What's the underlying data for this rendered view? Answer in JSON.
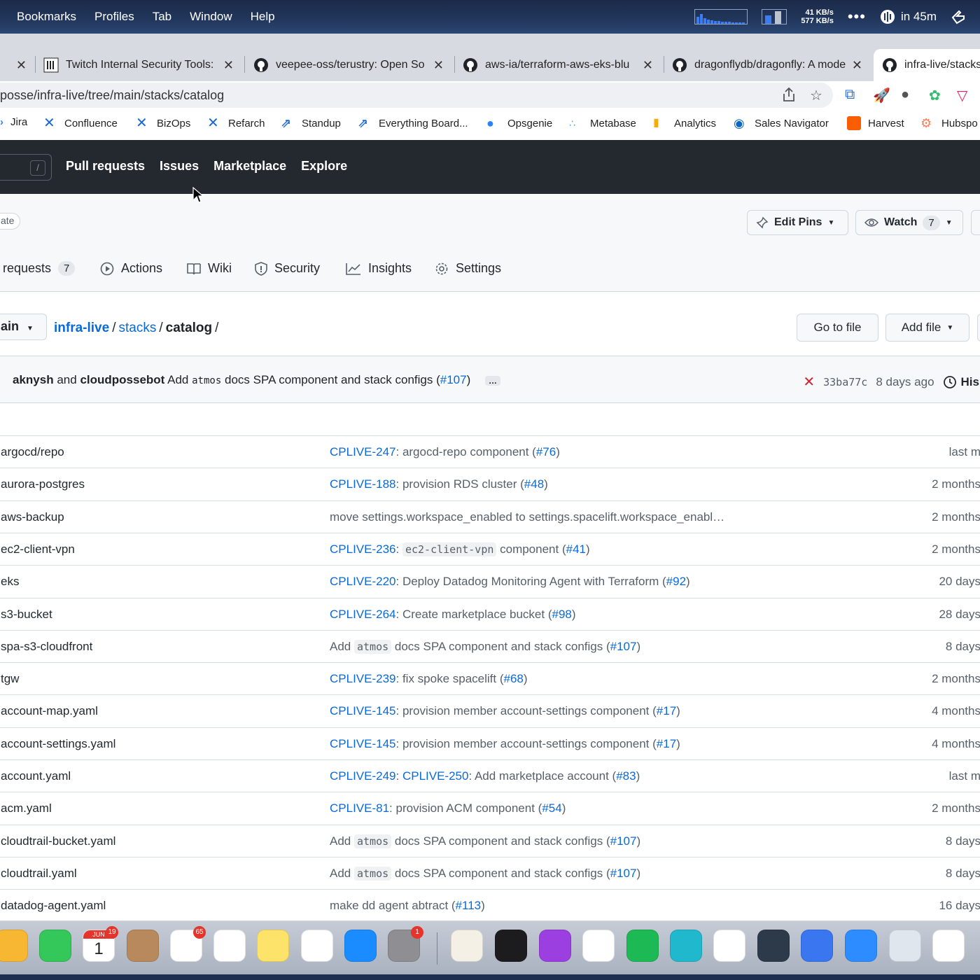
{
  "menubar": {
    "items": [
      "Bookmarks",
      "Profiles",
      "Tab",
      "Window",
      "Help"
    ],
    "net_up": "41 KB/s",
    "net_down": "577 KB/s",
    "more": "•••",
    "clock_text": "in 45m"
  },
  "tabs": [
    {
      "title": "Twitch Internal Security Tools:",
      "icon": "twitch-icon"
    },
    {
      "title": "veepee-oss/terustry: Open So",
      "icon": "github-icon"
    },
    {
      "title": "aws-ia/terraform-aws-eks-blu",
      "icon": "github-icon"
    },
    {
      "title": "dragonflydb/dragonfly: A mode",
      "icon": "github-icon"
    },
    {
      "title": "infra-live/stacks",
      "icon": "github-icon"
    }
  ],
  "address": {
    "url": "posse/infra-live/tree/main/stacks/catalog"
  },
  "bookmarks": [
    {
      "label": "Jira",
      "color": "#2684ff"
    },
    {
      "label": "Confluence",
      "color": "#1868db"
    },
    {
      "label": "BizOps",
      "color": "#1868db"
    },
    {
      "label": "Refarch",
      "color": "#1868db"
    },
    {
      "label": "Standup",
      "color": "#1868db"
    },
    {
      "label": "Everything Board...",
      "color": "#1868db"
    },
    {
      "label": "Opsgenie",
      "color": "#2684ff"
    },
    {
      "label": "Metabase",
      "color": "#509ee3"
    },
    {
      "label": "Analytics",
      "color": "#f9ab00"
    },
    {
      "label": "Sales Navigator",
      "color": "#0a66c2"
    },
    {
      "label": "Harvest",
      "color": "#fa5d00"
    },
    {
      "label": "Hubspo",
      "color": "#ff7a59"
    }
  ],
  "gh_nav": {
    "slash": "/",
    "items": [
      "Pull requests",
      "Issues",
      "Marketplace",
      "Explore"
    ]
  },
  "repo": {
    "visibility_pill": "ate",
    "edit_pins": "Edit Pins",
    "watch": "Watch",
    "watch_count": "7",
    "tabs": [
      {
        "label": "requests",
        "count": "7"
      },
      {
        "label": "Actions"
      },
      {
        "label": "Wiki"
      },
      {
        "label": "Security"
      },
      {
        "label": "Insights"
      },
      {
        "label": "Settings"
      }
    ]
  },
  "breadcrumb": {
    "branch": "ain",
    "root": "infra-live",
    "dir": "stacks",
    "current": "catalog",
    "sep": "/",
    "go_to_file": "Go to file",
    "add_file": "Add file"
  },
  "commit": {
    "author1": "aknysh",
    "and": "and",
    "author2": "cloudpossebot",
    "msg_pre": "Add",
    "msg_code": "atmos",
    "msg_post": "docs SPA component and stack configs (",
    "pr": "#107",
    "msg_close": ")",
    "ellipsis": "…",
    "status": "✕",
    "sha": "33ba77c",
    "age": "8 days ago",
    "history": "His"
  },
  "files": [
    {
      "name": "argocd/repo",
      "link": "CPLIVE-247",
      "text": ": argocd-repo component (",
      "pr": "#76",
      "age": "last m"
    },
    {
      "name": "aurora-postgres",
      "link": "CPLIVE-188",
      "text": ": provision RDS cluster (",
      "pr": "#48",
      "age": "2 months"
    },
    {
      "name": "aws-backup",
      "plain": "move settings.workspace_enabled to settings.spacelift.workspace_enabl…",
      "age": "2 months"
    },
    {
      "name": "ec2-client-vpn",
      "link": "CPLIVE-236",
      "text": ": ",
      "code": "ec2-client-vpn",
      "text2": " component (",
      "pr": "#41",
      "age": "2 months"
    },
    {
      "name": "eks",
      "link": "CPLIVE-220",
      "text": ": Deploy Datadog Monitoring Agent with Terraform (",
      "pr": "#92",
      "age": "20 days"
    },
    {
      "name": "s3-bucket",
      "link": "CPLIVE-264",
      "text": ": Create marketplace bucket (",
      "pr": "#98",
      "age": "28 days"
    },
    {
      "name": "spa-s3-cloudfront",
      "pre": "Add ",
      "code": "atmos",
      "text2": " docs SPA component and stack configs (",
      "pr": "#107",
      "age": "8 days"
    },
    {
      "name": "tgw",
      "link": "CPLIVE-239",
      "text": ": fix spoke spacelift (",
      "pr": "#68",
      "age": "2 months"
    },
    {
      "name": "account-map.yaml",
      "link": "CPLIVE-145",
      "text": ": provision member account-settings component (",
      "pr": "#17",
      "age": "4 months"
    },
    {
      "name": "account-settings.yaml",
      "link": "CPLIVE-145",
      "text": ": provision member account-settings component (",
      "pr": "#17",
      "age": "4 months"
    },
    {
      "name": "account.yaml",
      "link": "CPLIVE-249",
      "text": ": ",
      "link2": "CPLIVE-250",
      "text2": ": Add marketplace account (",
      "pr": "#83",
      "age": "last m"
    },
    {
      "name": "acm.yaml",
      "link": "CPLIVE-81",
      "text": ": provision ACM component (",
      "pr": "#54",
      "age": "2 months"
    },
    {
      "name": "cloudtrail-bucket.yaml",
      "pre": "Add ",
      "code": "atmos",
      "text2": " docs SPA component and stack configs (",
      "pr": "#107",
      "age": "8 days"
    },
    {
      "name": "cloudtrail.yaml",
      "pre": "Add ",
      "code": "atmos",
      "text2": " docs SPA component and stack configs (",
      "pr": "#107",
      "age": "8 days"
    },
    {
      "name": "datadog-agent.yaml",
      "pre": "make dd agent abtract (",
      "pr": "#113",
      "age": "16 days"
    }
  ],
  "dock": {
    "apps": [
      {
        "name": "photos-app",
        "color": "#f7b733"
      },
      {
        "name": "facetime-app",
        "color": "#34c759"
      },
      {
        "name": "calendar-app",
        "color": "#ffffff",
        "badge": "19",
        "month": "JUN",
        "day": "1"
      },
      {
        "name": "contacts-app",
        "color": "#b8895c"
      },
      {
        "name": "reminders-app",
        "color": "#ffffff",
        "badge": "65"
      },
      {
        "name": "slack-app",
        "color": "#ffffff"
      },
      {
        "name": "notes-app",
        "color": "#fde36a"
      },
      {
        "name": "news-app",
        "color": "#ffffff"
      },
      {
        "name": "appstore-app",
        "color": "#1a8cff"
      },
      {
        "name": "system-settings-app",
        "color": "#8e8e93",
        "badge": "1"
      },
      {
        "name": "textedit-app",
        "color": "#f5f0e6"
      },
      {
        "name": "terminal-app",
        "color": "#1c1c1e"
      },
      {
        "name": "podcasts-app",
        "color": "#9b3fe0"
      },
      {
        "name": "chrome-app",
        "color": "#ffffff"
      },
      {
        "name": "spotify-app",
        "color": "#1db954"
      },
      {
        "name": "perplexity-app",
        "color": "#20b8cd"
      },
      {
        "name": "evernote-app",
        "color": "#ffffff"
      },
      {
        "name": "quicktime-app",
        "color": "#2d3a4a"
      },
      {
        "name": "signal-app",
        "color": "#3a76f0"
      },
      {
        "name": "zoom-app",
        "color": "#2d8cff"
      },
      {
        "name": "preview-app",
        "color": "#dfe6ee"
      },
      {
        "name": "affinity-app",
        "color": "#ffffff"
      }
    ]
  },
  "colors": {
    "accent_link": "#0969da",
    "gh_header": "#24292f",
    "border": "#d0d7de"
  }
}
